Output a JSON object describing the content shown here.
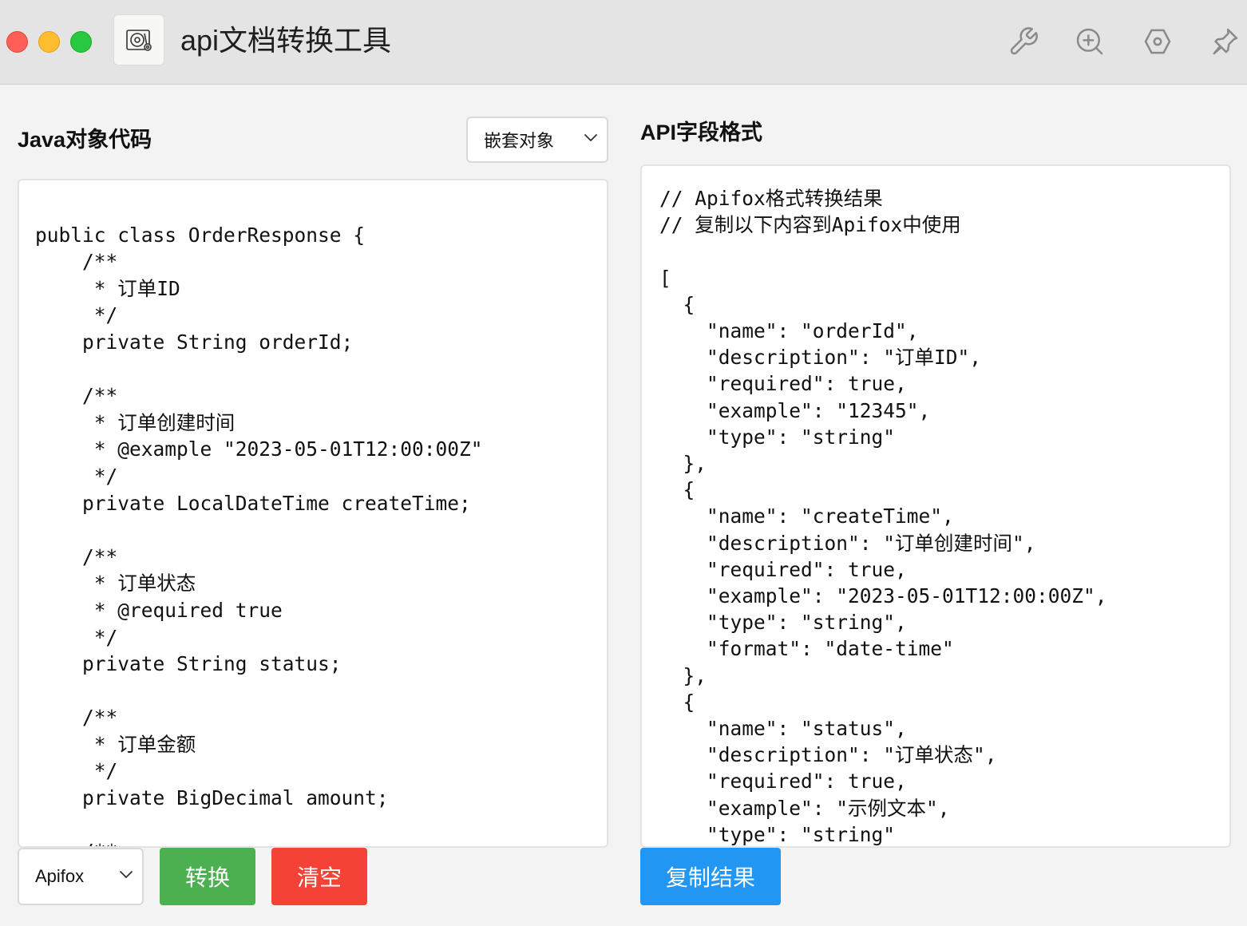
{
  "window": {
    "title": "api文档转换工具",
    "app_icon": "turntable-gear-icon",
    "toolbar_icons": [
      "wrench-icon",
      "zoom-in-icon",
      "hexagon-settings-icon",
      "pin-icon"
    ]
  },
  "left": {
    "title": "Java对象代码",
    "mode_select": {
      "value": "嵌套对象"
    },
    "code": "\npublic class OrderResponse {\n    /**\n     * 订单ID\n     */\n    private String orderId;\n\n    /**\n     * 订单创建时间\n     * @example \"2023-05-01T12:00:00Z\"\n     */\n    private LocalDateTime createTime;\n\n    /**\n     * 订单状态\n     * @required true\n     */\n    private String status;\n\n    /**\n     * 订单金额\n     */\n    private BigDecimal amount;\n\n    /**",
    "format_select": {
      "value": "Apifox"
    },
    "convert_label": "转换",
    "clear_label": "清空"
  },
  "right": {
    "title": "API字段格式",
    "output": "// Apifox格式转换结果\n// 复制以下内容到Apifox中使用\n\n[\n  {\n    \"name\": \"orderId\",\n    \"description\": \"订单ID\",\n    \"required\": true,\n    \"example\": \"12345\",\n    \"type\": \"string\"\n  },\n  {\n    \"name\": \"createTime\",\n    \"description\": \"订单创建时间\",\n    \"required\": true,\n    \"example\": \"2023-05-01T12:00:00Z\",\n    \"type\": \"string\",\n    \"format\": \"date-time\"\n  },\n  {\n    \"name\": \"status\",\n    \"description\": \"订单状态\",\n    \"required\": true,\n    \"example\": \"示例文本\",\n    \"type\": \"string\"",
    "copy_label": "复制结果"
  },
  "colors": {
    "convert": "#4caf50",
    "clear": "#f44336",
    "copy": "#2196f3"
  }
}
